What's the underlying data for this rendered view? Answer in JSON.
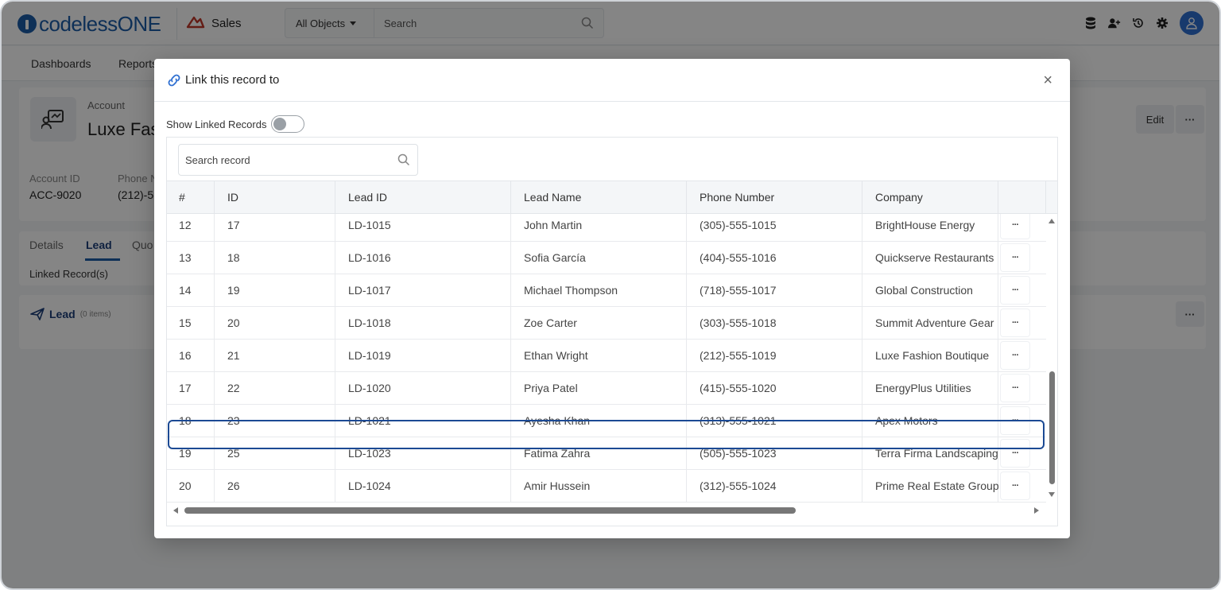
{
  "app": {
    "logo_text": "codelessONE",
    "app_name": "Sales",
    "object_select": "All Objects",
    "search_placeholder": "Search"
  },
  "nav": {
    "items": [
      "Dashboards",
      "Reports"
    ]
  },
  "record": {
    "type_label": "Account",
    "name": "Luxe Fas",
    "edit_label": "Edit",
    "more_label": "···",
    "fields": [
      {
        "label": "Account ID",
        "value": "ACC-9020"
      },
      {
        "label": "Phone N",
        "value": "(212)-5"
      }
    ]
  },
  "tabs": {
    "items": [
      "Details",
      "Lead",
      "Quo"
    ],
    "active": "Lead",
    "linked_records": "Linked Record(s)"
  },
  "lead_section": {
    "title": "Lead",
    "count": "(0 items)"
  },
  "modal": {
    "title": "Link this record to",
    "close": "×",
    "show_linked_label": "Show Linked Records",
    "search_placeholder": "Search record",
    "columns": [
      "#",
      "ID",
      "Lead ID",
      "Lead Name",
      "Phone Number",
      "Company"
    ],
    "rows": [
      {
        "n": "12",
        "id": "17",
        "lead_id": "LD-1015",
        "name": "John Martin",
        "phone": "(305)-555-1015",
        "company": "BrightHouse Energy"
      },
      {
        "n": "13",
        "id": "18",
        "lead_id": "LD-1016",
        "name": "Sofia García",
        "phone": "(404)-555-1016",
        "company": "Quickserve Restaurants"
      },
      {
        "n": "14",
        "id": "19",
        "lead_id": "LD-1017",
        "name": "Michael Thompson",
        "phone": "(718)-555-1017",
        "company": "Global Construction"
      },
      {
        "n": "15",
        "id": "20",
        "lead_id": "LD-1018",
        "name": "Zoe Carter",
        "phone": "(303)-555-1018",
        "company": "Summit Adventure Gear"
      },
      {
        "n": "16",
        "id": "21",
        "lead_id": "LD-1019",
        "name": "Ethan Wright",
        "phone": "(212)-555-1019",
        "company": "Luxe Fashion Boutique"
      },
      {
        "n": "17",
        "id": "22",
        "lead_id": "LD-1020",
        "name": "Priya Patel",
        "phone": "(415)-555-1020",
        "company": "EnergyPlus Utilities"
      },
      {
        "n": "18",
        "id": "23",
        "lead_id": "LD-1021",
        "name": "Ayesha Khan",
        "phone": "(313)-555-1021",
        "company": "Apex Motors"
      },
      {
        "n": "19",
        "id": "25",
        "lead_id": "LD-1023",
        "name": "Fatima Zahra",
        "phone": "(505)-555-1023",
        "company": "Terra Firma Landscaping"
      },
      {
        "n": "20",
        "id": "26",
        "lead_id": "LD-1024",
        "name": "Amir Hussein",
        "phone": "(312)-555-1024",
        "company": "Prime Real Estate Group"
      }
    ],
    "row_more_label": "···",
    "highlighted_row": "16"
  },
  "colors": {
    "brand": "#1c5ca8",
    "highlight_border": "#1c4a94",
    "avatar": "#2e6fd1",
    "app_icon": "#c0392b"
  }
}
